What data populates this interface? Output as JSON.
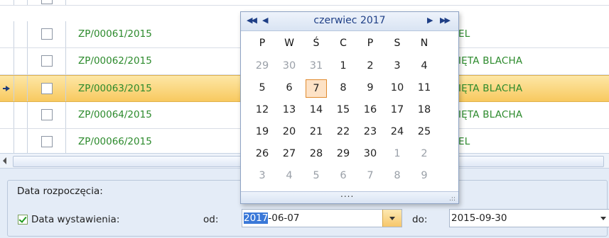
{
  "rows": [
    {
      "code": "ZP/00061/2015",
      "right": "EL"
    },
    {
      "code": "ZP/00062/2015",
      "right": "IĘTA BLACHA"
    },
    {
      "code": "ZP/00063/2015",
      "right": "IĘTA BLACHA"
    },
    {
      "code": "ZP/00064/2015",
      "right": "IĘTA BLACHA"
    },
    {
      "code": "ZP/00066/2015",
      "right": "EL"
    }
  ],
  "filters": {
    "group_title": "Data rozpoczęcia:",
    "date_label": "Data wystawienia:",
    "from_label": "od:",
    "to_label": "do:",
    "from_year": "2017",
    "from_rest": "-06-07",
    "to_value": "2015-09-30"
  },
  "calendar": {
    "month_label": "czerwiec 2017",
    "nav_prev_year": "◀◀",
    "nav_prev": "◀",
    "nav_next": "▶",
    "nav_next_year": "▶▶",
    "weekdays": [
      "P",
      "W",
      "Ś",
      "C",
      "P",
      "S",
      "N"
    ],
    "weeks": [
      [
        "29",
        "30",
        "31",
        "1",
        "2",
        "3",
        "4"
      ],
      [
        "5",
        "6",
        "7",
        "8",
        "9",
        "10",
        "11"
      ],
      [
        "12",
        "13",
        "14",
        "15",
        "16",
        "17",
        "18"
      ],
      [
        "19",
        "20",
        "21",
        "22",
        "23",
        "24",
        "25"
      ],
      [
        "26",
        "27",
        "28",
        "29",
        "30",
        "1",
        "2"
      ],
      [
        "3",
        "4",
        "5",
        "6",
        "7",
        "8",
        "9"
      ]
    ],
    "footer_dots": "....",
    "grip": ".::"
  }
}
